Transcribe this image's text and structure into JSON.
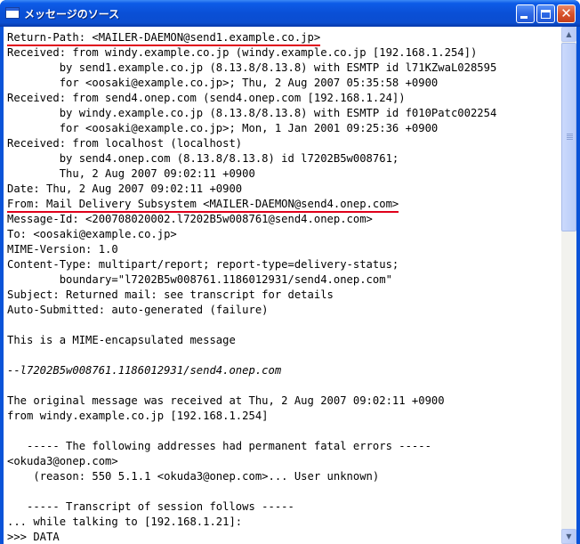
{
  "window": {
    "title": "メッセージのソース",
    "buttons": {
      "minimize": "minimize",
      "maximize": "maximize",
      "close": "close"
    }
  },
  "source_lines": [
    {
      "text": "Return-Path: <MAILER-DAEMON@send1.example.co.jp>",
      "underline": true
    },
    {
      "text": "Received: from windy.example.co.jp (windy.example.co.jp [192.168.1.254])"
    },
    {
      "text": "        by send1.example.co.jp (8.13.8/8.13.8) with ESMTP id l71KZwaL028595"
    },
    {
      "text": "        for <oosaki@example.co.jp>; Thu, 2 Aug 2007 05:35:58 +0900"
    },
    {
      "text": "Received: from send4.onep.com (send4.onep.com [192.168.1.24])"
    },
    {
      "text": "        by windy.example.co.jp (8.13.8/8.13.8) with ESMTP id f010Patc002254"
    },
    {
      "text": "        for <oosaki@example.co.jp>; Mon, 1 Jan 2001 09:25:36 +0900"
    },
    {
      "text": "Received: from localhost (localhost)"
    },
    {
      "text": "        by send4.onep.com (8.13.8/8.13.8) id l7202B5w008761;"
    },
    {
      "text": "        Thu, 2 Aug 2007 09:02:11 +0900"
    },
    {
      "text": "Date: Thu, 2 Aug 2007 09:02:11 +0900"
    },
    {
      "text": "From: Mail Delivery Subsystem <MAILER-DAEMON@send4.onep.com>",
      "underline": true
    },
    {
      "text": "Message-Id: <200708020002.l7202B5w008761@send4.onep.com>"
    },
    {
      "text": "To: <oosaki@example.co.jp>"
    },
    {
      "text": "MIME-Version: 1.0"
    },
    {
      "text": "Content-Type: multipart/report; report-type=delivery-status;"
    },
    {
      "text": "        boundary=\"l7202B5w008761.1186012931/send4.onep.com\""
    },
    {
      "text": "Subject: Returned mail: see transcript for details"
    },
    {
      "text": "Auto-Submitted: auto-generated (failure)"
    },
    {
      "text": ""
    },
    {
      "text": "This is a MIME-encapsulated message"
    },
    {
      "text": ""
    },
    {
      "text": "--l7202B5w008761.1186012931/send4.onep.com",
      "italic": true
    },
    {
      "text": ""
    },
    {
      "text": "The original message was received at Thu, 2 Aug 2007 09:02:11 +0900"
    },
    {
      "text": "from windy.example.co.jp [192.168.1.254]"
    },
    {
      "text": ""
    },
    {
      "text": "   ----- The following addresses had permanent fatal errors -----"
    },
    {
      "text": "<okuda3@onep.com>"
    },
    {
      "text": "    (reason: 550 5.1.1 <okuda3@onep.com>... User unknown)"
    },
    {
      "text": ""
    },
    {
      "text": "   ----- Transcript of session follows -----"
    },
    {
      "text": "... while talking to [192.168.1.21]:"
    },
    {
      "text": ">>> DATA"
    }
  ],
  "scrollbar": {
    "up_icon": "up-arrow-icon",
    "down_icon": "down-arrow-icon",
    "scroll_fraction": 0.0
  },
  "colors": {
    "titlebar": "#0a4fd6",
    "underline": "#e0001a",
    "text": "#000000"
  }
}
